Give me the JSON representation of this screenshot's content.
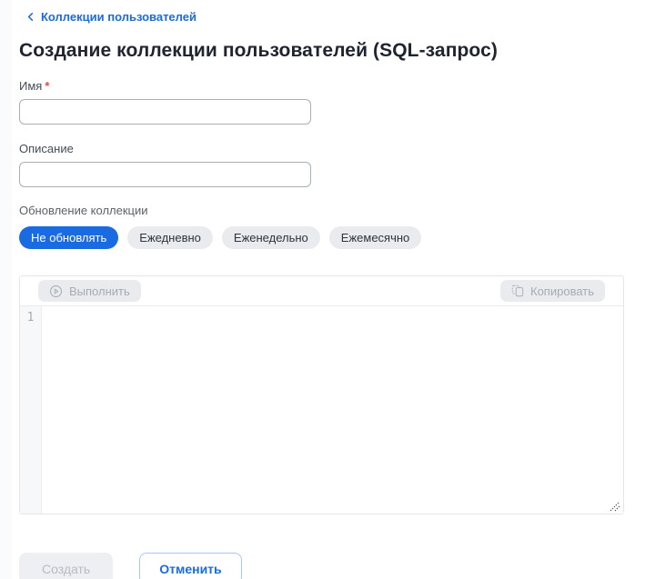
{
  "colors": {
    "accent_blue": "#1a6be2",
    "required_red": "#e5484d",
    "disabled_text": "#b7bcc4",
    "pill_inactive_bg": "#e9ebee"
  },
  "breadcrumb": {
    "label": "Коллекции пользователей",
    "icon": "chevron-left-icon"
  },
  "page": {
    "title": "Создание коллекции пользователей (SQL-запрос)"
  },
  "form": {
    "name_field": {
      "label": "Имя",
      "required_marker": "*",
      "value": "",
      "placeholder": ""
    },
    "description_field": {
      "label": "Описание",
      "value": "",
      "placeholder": ""
    },
    "refresh": {
      "label": "Обновление коллекции",
      "options": [
        {
          "label": "Не обновлять",
          "selected": true
        },
        {
          "label": "Ежедневно",
          "selected": false
        },
        {
          "label": "Еженедельно",
          "selected": false
        },
        {
          "label": "Ежемесячно",
          "selected": false
        }
      ]
    }
  },
  "sql_editor": {
    "run_button": {
      "label": "Выполнить",
      "disabled": true,
      "icon": "play-circle-icon"
    },
    "copy_button": {
      "label": "Копировать",
      "disabled": true,
      "icon": "copy-icon"
    },
    "line_numbers": [
      "1"
    ],
    "content": ""
  },
  "footer": {
    "create_button": {
      "label": "Создать",
      "disabled": true
    },
    "cancel_button": {
      "label": "Отменить",
      "disabled": false
    }
  }
}
